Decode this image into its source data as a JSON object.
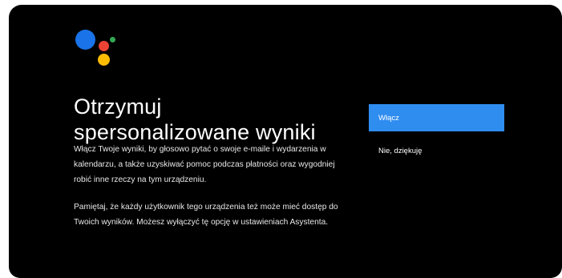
{
  "logo": {
    "name": "google-assistant-logo",
    "colors": {
      "blue": "#1a73e8",
      "red": "#ea4335",
      "yellow": "#fbbc04",
      "green": "#34a853"
    }
  },
  "title": {
    "line1": "Otrzymuj",
    "line2": "spersonalizowane wyniki"
  },
  "description": {
    "paragraph1": "Włącz Twoje wyniki, by głosowo pytać o swoje e-maile i wydarzenia w kalendarzu, a także uzyskiwać pomoc podczas płatności oraz wygodniej robić inne rzeczy na tym urządzeniu.",
    "paragraph2": "Pamiętaj, że każdy użytkownik tego urządzenia też może mieć dostęp do Twoich wyników. Możesz wyłączyć tę opcję w ustawieniach Asystenta."
  },
  "actions": {
    "enable_label": "Włącz",
    "decline_label": "Nie, dziękuję"
  },
  "colors": {
    "background": "#000000",
    "accent": "#2f8df0",
    "text": "#ffffff"
  }
}
